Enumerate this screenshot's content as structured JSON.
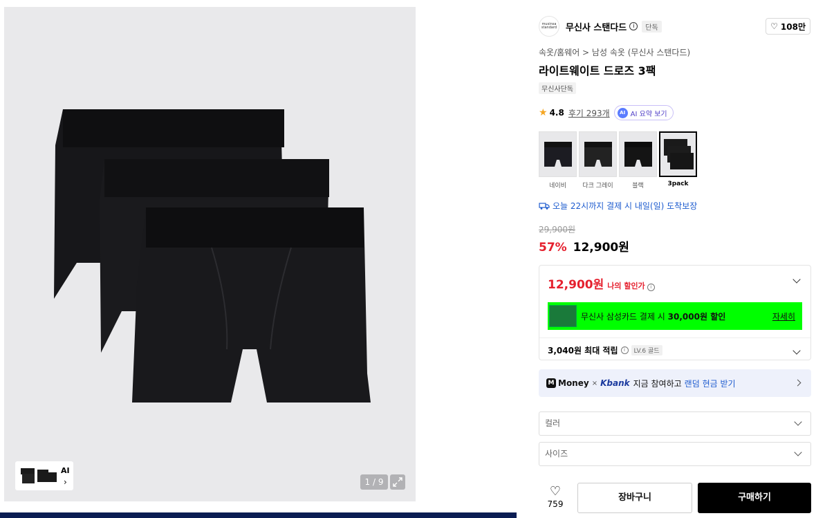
{
  "gallery": {
    "thumb_ai_label": "AI",
    "page_counter": "1 / 9"
  },
  "brand": {
    "logo_text": "musinsa standard",
    "name": "무신사 스탠다드",
    "tag": "단독",
    "like_count": "108만"
  },
  "product": {
    "breadcrumb": "속옷/홈웨어 > 남성 속옷 (무신사 스탠다드)",
    "title": "라이트웨이트 드로즈 3팩",
    "exclusive_tag": "무신사단독",
    "rating": "4.8",
    "reviews": "후기 293개",
    "ai_badge": "AI",
    "ai_summary": "AI 요약 보기"
  },
  "variants": [
    {
      "label": "네이비",
      "selected": false
    },
    {
      "label": "다크 그레이",
      "selected": false
    },
    {
      "label": "블랙",
      "selected": false
    },
    {
      "label": "3pack",
      "selected": true
    }
  ],
  "delivery": "오늘 22시까지 결제 시 내일(일) 도착보장",
  "pricing": {
    "original": "29,900원",
    "discount": "57%",
    "price": "12,900원"
  },
  "benefits": {
    "my_price": "12,900원",
    "my_price_label": "나의 할인가",
    "card_prefix": "무신사 삼성카드 결제 시 ",
    "card_amount": "30,000원 할인",
    "card_link": "자세히",
    "card_bg_color": "#00ff00",
    "points": "3,040원 최대 적립",
    "level": "LV.6 골드"
  },
  "kbank": {
    "m_badge": "M",
    "money": "Money",
    "times": "×",
    "kbank": "Kbank",
    "text": "지금 참여하고",
    "link": "랜덤 현금 받기"
  },
  "options": {
    "color_placeholder": "컬러",
    "size_placeholder": "사이즈"
  },
  "actions": {
    "wish_count": "759",
    "cart": "장바구니",
    "buy": "구매하기"
  }
}
